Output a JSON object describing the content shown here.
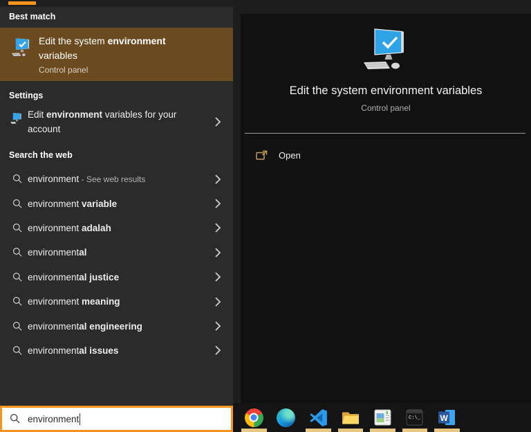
{
  "colors": {
    "accent_orange": "#f7941d",
    "best_match_highlight": "#6b4a20",
    "left_panel_bg": "#2b2b2b",
    "preview_panel_bg": "#111111",
    "taskbar_indicator": "#e8c782",
    "open_icon_gold": "#c49a5b"
  },
  "left_panel": {
    "best_match": {
      "header": "Best match",
      "item": {
        "icon": "pc-check-icon",
        "title_parts": [
          {
            "t": "Edit the system "
          },
          {
            "t": "environment",
            "b": true
          },
          {
            "t": " variables"
          }
        ],
        "subtitle": "Control panel"
      }
    },
    "settings": {
      "header": "Settings",
      "item": {
        "icon": "pc-display-icon",
        "title_parts": [
          {
            "t": "Edit "
          },
          {
            "t": "environment",
            "b": true
          },
          {
            "t": " variables for your account"
          }
        ]
      }
    },
    "search_web": {
      "header": "Search the web",
      "items": [
        {
          "parts": [
            {
              "t": "environment"
            },
            {
              "t": " - See web results",
              "m": true
            }
          ]
        },
        {
          "parts": [
            {
              "t": "environment "
            },
            {
              "t": "variable",
              "b": true
            }
          ]
        },
        {
          "parts": [
            {
              "t": "environment "
            },
            {
              "t": "adalah",
              "b": true
            }
          ]
        },
        {
          "parts": [
            {
              "t": "environment"
            },
            {
              "t": "al",
              "b": true
            }
          ]
        },
        {
          "parts": [
            {
              "t": "environment"
            },
            {
              "t": "al justice",
              "b": true
            }
          ]
        },
        {
          "parts": [
            {
              "t": "environment "
            },
            {
              "t": "meaning",
              "b": true
            }
          ]
        },
        {
          "parts": [
            {
              "t": "environment"
            },
            {
              "t": "al engineering",
              "b": true
            }
          ]
        },
        {
          "parts": [
            {
              "t": "environment"
            },
            {
              "t": "al issues",
              "b": true
            }
          ]
        }
      ]
    },
    "search_box": {
      "value": "environment",
      "icon": "search-icon"
    }
  },
  "preview_panel": {
    "icon": "pc-check-icon-large",
    "title": "Edit the system environment variables",
    "subtitle": "Control panel",
    "actions": [
      {
        "label": "Open",
        "icon": "open-external-icon"
      }
    ]
  },
  "taskbar": {
    "icons": [
      {
        "name": "chrome",
        "indicator": true
      },
      {
        "name": "edge",
        "indicator": false
      },
      {
        "name": "vscode",
        "indicator": true
      },
      {
        "name": "file-explorer",
        "indicator": true
      },
      {
        "name": "system-window",
        "indicator": true
      },
      {
        "name": "command-prompt",
        "indicator": true
      },
      {
        "name": "word",
        "indicator": true
      }
    ],
    "glyphs": {
      "word": "W",
      "command_prompt": "C:\\_"
    }
  }
}
